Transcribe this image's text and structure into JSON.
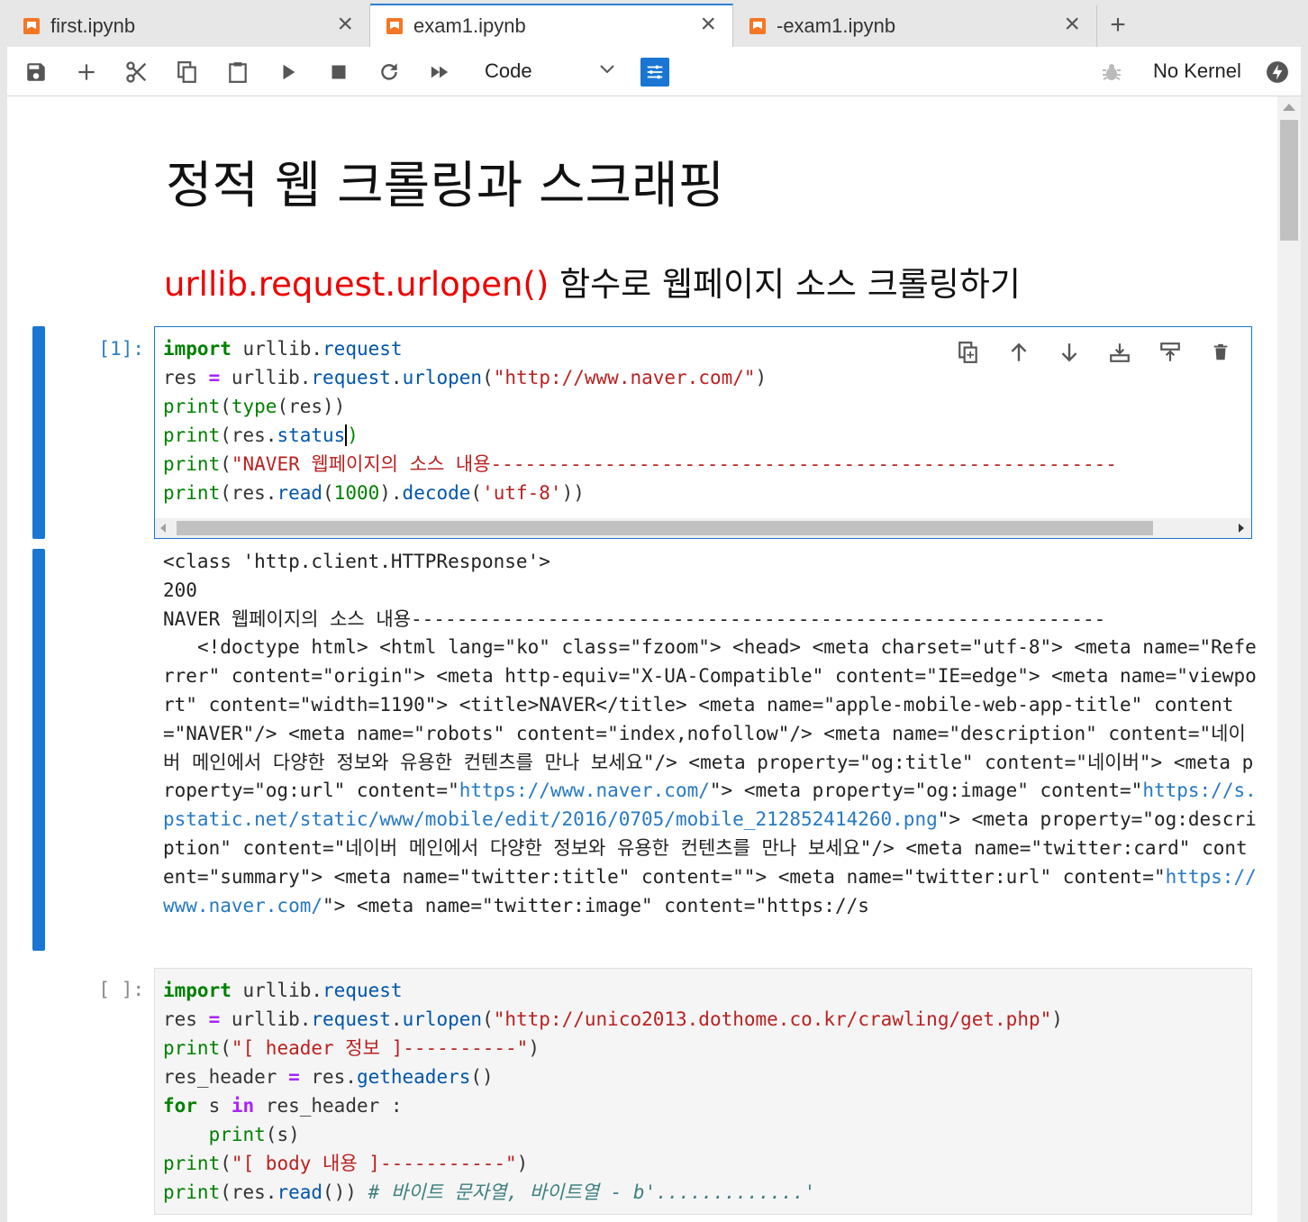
{
  "tabs": [
    {
      "label": "first.ipynb",
      "active": false
    },
    {
      "label": "exam1.ipynb",
      "active": true
    },
    {
      "label": "-exam1.ipynb",
      "active": false
    }
  ],
  "toolbar": {
    "cell_type": "Code",
    "kernel_status": "No Kernel"
  },
  "notebook": {
    "title": "정적 웹 크롤링과 스크래핑",
    "subtitle_red": "urllib.request.urlopen()",
    "subtitle_rest": " 함수로 웹페이지 소스 크롤링하기",
    "cell1": {
      "prompt": "[1]:",
      "lines": [
        "import urllib.request",
        "res = urllib.request.urlopen(\"http://www.naver.com/\")",
        "print(type(res))",
        "print(res.status)",
        "print(\"NAVER 웹페이지의 소스 내용-------------------------------------------------------",
        "print(res.read(1000).decode('utf-8'))"
      ]
    },
    "output1": {
      "line1": "<class 'http.client.HTTPResponse'>",
      "line2": "200",
      "line3": "NAVER 웹페이지의 소스 내용-------------------------------------------------------------",
      "body_a": "   <!doctype html> <html lang=\"ko\" class=\"fzoom\"> <head> <meta charset=\"utf-8\"> <meta name=\"Referrer\" content=\"origin\"> <meta http-equiv=\"X-UA-Compatible\" content=\"IE=edge\"> <meta name=\"viewport\" content=\"width=1190\"> <title>NAVER</title> <meta name=\"apple-mobile-web-app-title\" content=\"NAVER\"/> <meta name=\"robots\" content=\"index,nofollow\"/> <meta name=\"description\" content=\"네이버 메인에서 다양한 정보와 유용한 컨텐츠를 만나 보세요\"/> <meta property=\"og:title\" content=\"네이버\"> <meta property=\"og:url\" content=\"",
      "link1": "https://www.naver.com/",
      "body_b": "\"> <meta property=\"og:image\" content=\"",
      "link2": "https://s.pstatic.net/static/www/mobile/edit/2016/0705/mobile_212852414260.png",
      "body_c": "\"> <meta property=\"og:description\" content=\"네이버 메인에서 다양한 정보와 유용한 컨텐츠를 만나 보세요\"/> <meta name=\"twitter:card\" content=\"summary\"> <meta name=\"twitter:title\" content=\"\"> <meta name=\"twitter:url\" content=\"",
      "link3": "https://www.naver.com/",
      "body_d": "\"> <meta name=\"twitter:image\" content=\"https://s"
    },
    "cell2": {
      "prompt": "[ ]:",
      "lines": [
        "import urllib.request",
        "res = urllib.request.urlopen(\"http://unico2013.dothome.co.kr/crawling/get.php\")",
        "print(\"[ header 정보 ]----------\")",
        "res_header = res.getheaders()",
        "for s in res_header :",
        "    print(s)",
        "print(\"[ body 내용 ]-----------\")",
        "print(res.read()) # 바이트 문자열, 바이트열 - b'.............'"
      ]
    }
  },
  "colors": {
    "accent": "#1976d2",
    "tab_icon": "#f37726",
    "heading_red": "#ee0000"
  },
  "icons": [
    "save-icon",
    "add-icon",
    "cut-icon",
    "copy-icon",
    "paste-icon",
    "run-icon",
    "stop-icon",
    "restart-icon",
    "fast-forward-icon",
    "chevron-down-icon",
    "property-inspector-icon",
    "bug-icon",
    "kernel-status-icon"
  ]
}
